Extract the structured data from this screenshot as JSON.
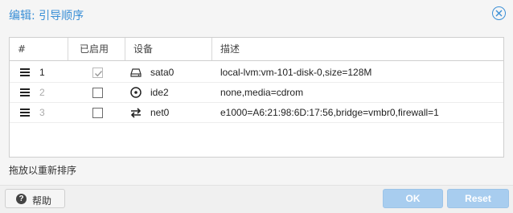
{
  "dialog": {
    "title": "编辑: 引导顺序",
    "close_icon": "close-circle-icon",
    "accent_color": "#3a8fd6"
  },
  "grid": {
    "columns": [
      "#",
      "已启用",
      "设备",
      "描述"
    ],
    "rows": [
      {
        "order": "1",
        "enabled": true,
        "device_icon": "harddisk-icon",
        "device": "sata0",
        "description": "local-lvm:vm-101-disk-0,size=128M"
      },
      {
        "order": "2",
        "enabled": false,
        "device_icon": "cdrom-icon",
        "device": "ide2",
        "description": "none,media=cdrom"
      },
      {
        "order": "3",
        "enabled": false,
        "device_icon": "network-exchange-icon",
        "device": "net0",
        "description": "e1000=A6:21:98:6D:17:56,bridge=vmbr0,firewall=1"
      }
    ]
  },
  "hint": "拖放以重新排序",
  "toolbar": {
    "help_label": "帮助",
    "ok_label": "OK",
    "reset_label": "Reset"
  }
}
